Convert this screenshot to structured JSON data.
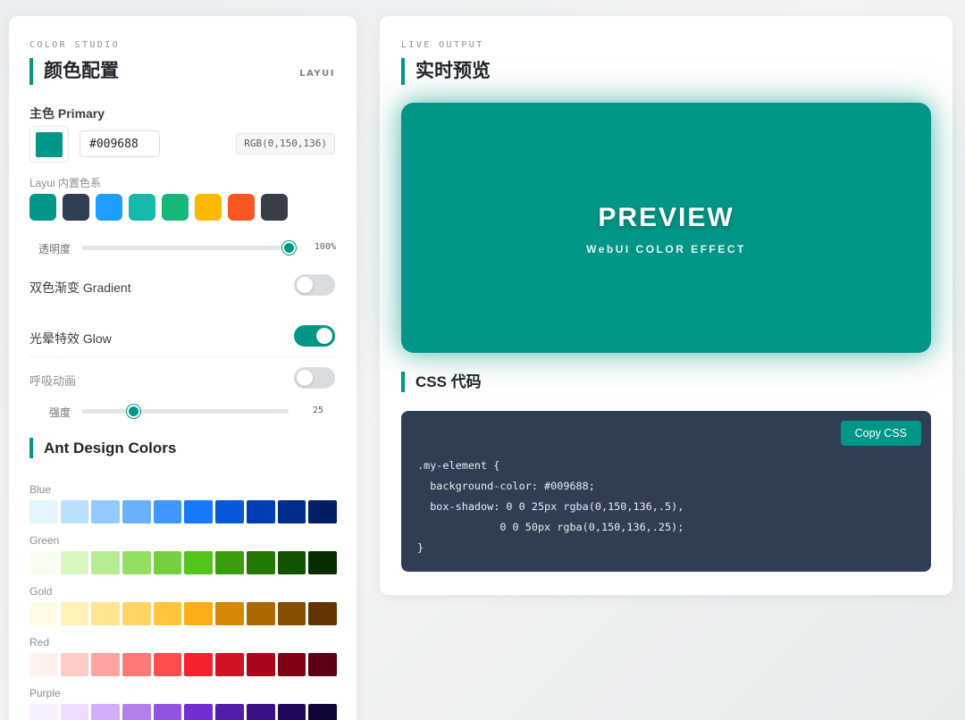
{
  "left": {
    "eyebrow": "COLOR STUDIO",
    "title": "颜色配置",
    "brand": "LAYUI",
    "primary_label": "主色 Primary",
    "primary_color": "#009688",
    "hex_value": "#009688",
    "rgb_text": "RGB(0,150,136)",
    "builtin_label": "Layui 内置色系",
    "builtin_palette": [
      "#009688",
      "#2f3e52",
      "#1e9fff",
      "#16baaa",
      "#16b777",
      "#ffb800",
      "#ff5722",
      "#393d49"
    ],
    "opacity": {
      "label": "透明度",
      "value": 1.0,
      "display": "100%"
    },
    "gradient": {
      "label": "双色渐变 Gradient",
      "on": false
    },
    "glow": {
      "label": "光晕特效 Glow",
      "on": true
    },
    "breath": {
      "label": "呼吸动画",
      "on": false
    },
    "strength": {
      "label": "强度",
      "value": 25,
      "min": 0,
      "max": 100,
      "display": "25"
    },
    "ant_title": "Ant Design Colors",
    "ramps": [
      {
        "name": "Blue",
        "colors": [
          "#e6f4ff",
          "#bae0ff",
          "#91caff",
          "#69b1ff",
          "#4096ff",
          "#1677ff",
          "#0958d9",
          "#003eb3",
          "#002c8c",
          "#001d66"
        ]
      },
      {
        "name": "Green",
        "colors": [
          "#f6ffed",
          "#d9f7be",
          "#b7eb8f",
          "#95de64",
          "#73d13d",
          "#52c41a",
          "#389e0d",
          "#237804",
          "#135200",
          "#092b00"
        ]
      },
      {
        "name": "Gold",
        "colors": [
          "#fffbe6",
          "#fff1b8",
          "#ffe58f",
          "#ffd666",
          "#ffc53d",
          "#faad14",
          "#d48806",
          "#ad6800",
          "#874d00",
          "#613400"
        ]
      },
      {
        "name": "Red",
        "colors": [
          "#fff1f0",
          "#ffccc7",
          "#ffa39e",
          "#ff7875",
          "#ff4d4f",
          "#f5222d",
          "#cf1322",
          "#a8071a",
          "#820014",
          "#5c0011"
        ]
      },
      {
        "name": "Purple",
        "colors": [
          "#f9f0ff",
          "#efdbff",
          "#d3adf7",
          "#b37feb",
          "#9254de",
          "#722ed1",
          "#531dab",
          "#391085",
          "#22075e",
          "#120338"
        ]
      }
    ]
  },
  "right": {
    "eyebrow": "LIVE OUTPUT",
    "title": "实时预览",
    "preview_title": "PREVIEW",
    "preview_sub": "WebUI COLOR EFFECT",
    "css_title": "CSS 代码",
    "copy_label": "Copy CSS",
    "code": ".my-element {\n  background-color: #009688;\n  box-shadow: 0 0 25px rgba(0,150,136,.5),\n             0 0 50px rgba(0,150,136,.25);\n}"
  }
}
